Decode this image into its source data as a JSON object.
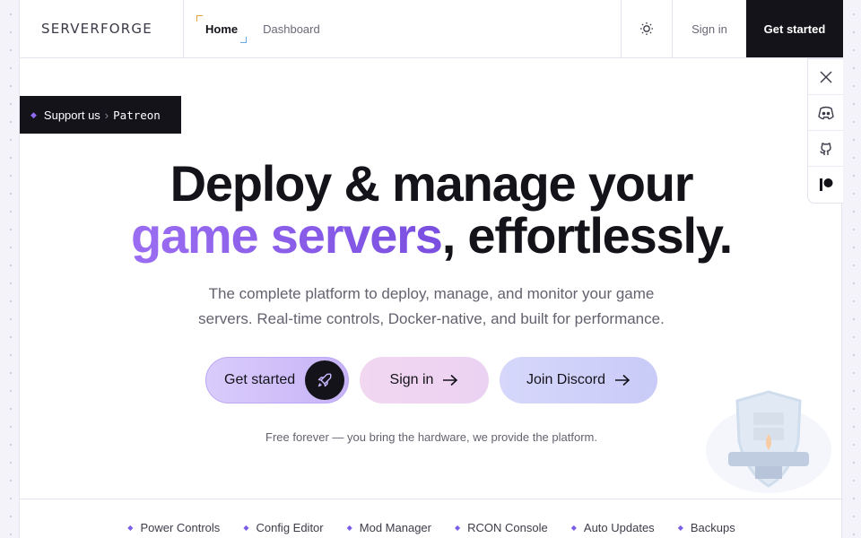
{
  "header": {
    "brand": "SERVERFORGE",
    "nav": [
      {
        "label": "Home",
        "active": true
      },
      {
        "label": "Dashboard",
        "active": false
      }
    ],
    "theme_toggle_icon": "sun-icon",
    "sign_in": "Sign in",
    "get_started": "Get started"
  },
  "support": {
    "label": "Support us",
    "target": "Patreon"
  },
  "social": [
    {
      "name": "x-icon"
    },
    {
      "name": "discord-icon"
    },
    {
      "name": "github-icon"
    },
    {
      "name": "patreon-icon"
    }
  ],
  "hero": {
    "line1": "Deploy & manage your",
    "highlight": "game servers",
    "line2_rest": ", effortlessly.",
    "subtitle": "The complete platform to deploy, manage, and monitor your game servers. Real-time controls, Docker-native, and built for performance.",
    "cta_start": "Get started",
    "cta_signin": "Sign in",
    "cta_discord": "Join Discord",
    "note": "Free forever — you bring the hardware, we provide the platform."
  },
  "features": [
    "Power Controls",
    "Config Editor",
    "Mod Manager",
    "RCON Console",
    "Auto Updates",
    "Backups"
  ],
  "colors": {
    "accent": "#7a4fe0",
    "dark": "#14131a"
  }
}
